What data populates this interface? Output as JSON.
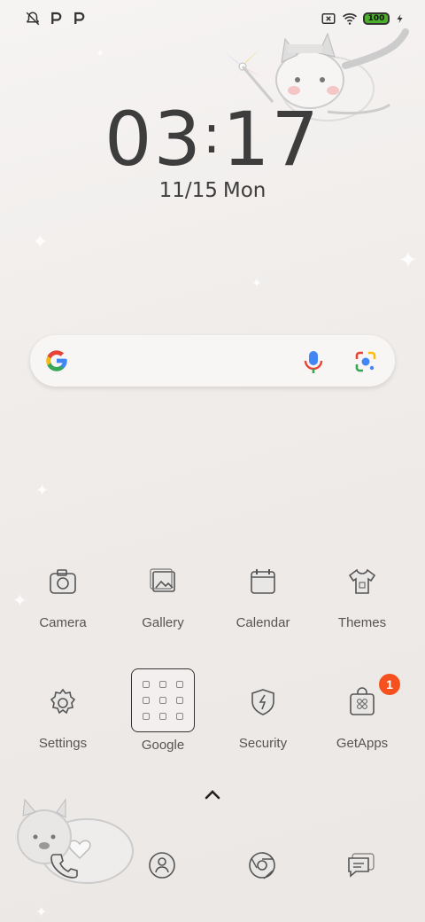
{
  "status_bar": {
    "left_icons": [
      "notifications-off-icon",
      "p-icon",
      "p-icon"
    ],
    "right_icons": [
      "sim-off-icon",
      "wifi-icon",
      "battery-icon",
      "charging-icon"
    ],
    "battery_level": "100"
  },
  "clock": {
    "time_hour": "03",
    "time_sep": ":",
    "time_minute": "17",
    "date_numeric": "11/15",
    "date_weekday": "Mon"
  },
  "search_bar": {
    "logo": "google-g-icon",
    "mic": "mic-icon",
    "lens": "lens-icon"
  },
  "apps": [
    {
      "label": "Camera",
      "icon": "camera-icon"
    },
    {
      "label": "Gallery",
      "icon": "gallery-icon"
    },
    {
      "label": "Calendar",
      "icon": "calendar-icon"
    },
    {
      "label": "Themes",
      "icon": "themes-icon"
    },
    {
      "label": "Settings",
      "icon": "settings-icon"
    },
    {
      "label": "Google",
      "icon": "folder-icon"
    },
    {
      "label": "Security",
      "icon": "security-icon"
    },
    {
      "label": "GetApps",
      "icon": "getapps-icon",
      "badge": "1"
    }
  ],
  "dock": [
    {
      "icon": "phone-icon"
    },
    {
      "icon": "contacts-icon"
    },
    {
      "icon": "browser-icon"
    },
    {
      "icon": "messages-icon"
    }
  ],
  "colors": {
    "badge": "#f4511e",
    "battery_fill": "#4caf2c",
    "text": "#3d3d3d"
  }
}
